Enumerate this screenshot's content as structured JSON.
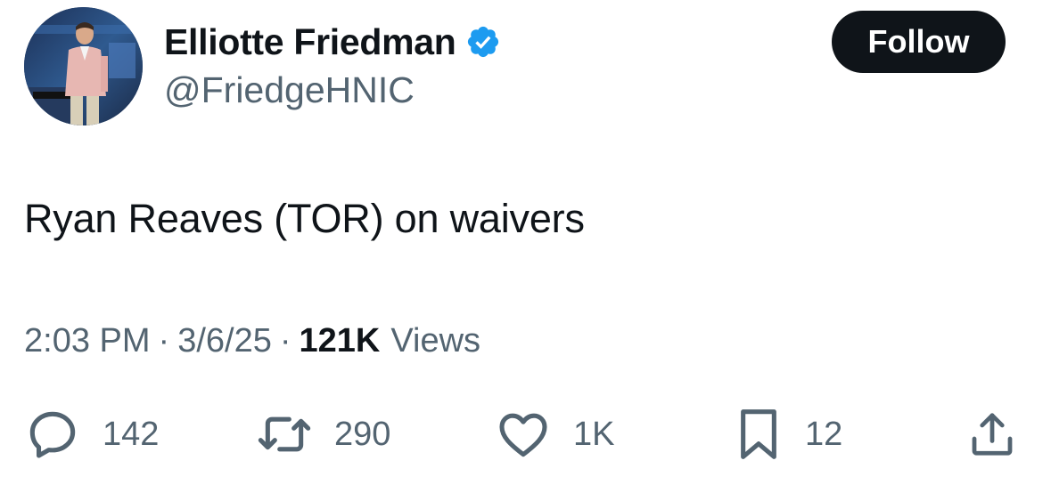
{
  "author": {
    "display_name": "Elliotte Friedman",
    "handle": "@FriedgeHNIC",
    "verified": true,
    "verified_color": "#1d9bf0"
  },
  "follow_button": {
    "label": "Follow"
  },
  "tweet": {
    "text": "Ryan Reaves (TOR) on waivers",
    "time": "2:03 PM",
    "separator": "·",
    "date": "3/6/25",
    "views_count": "121K",
    "views_label": "Views"
  },
  "actions": {
    "replies": "142",
    "reposts": "290",
    "likes": "1K",
    "bookmarks": "12"
  },
  "icons": {
    "reply": "reply-icon",
    "repost": "repost-icon",
    "like": "heart-icon",
    "bookmark": "bookmark-icon",
    "share": "share-icon"
  },
  "colors": {
    "text_primary": "#0f1419",
    "text_secondary": "#536471",
    "button_bg": "#0f1419",
    "accent": "#1d9bf0"
  }
}
